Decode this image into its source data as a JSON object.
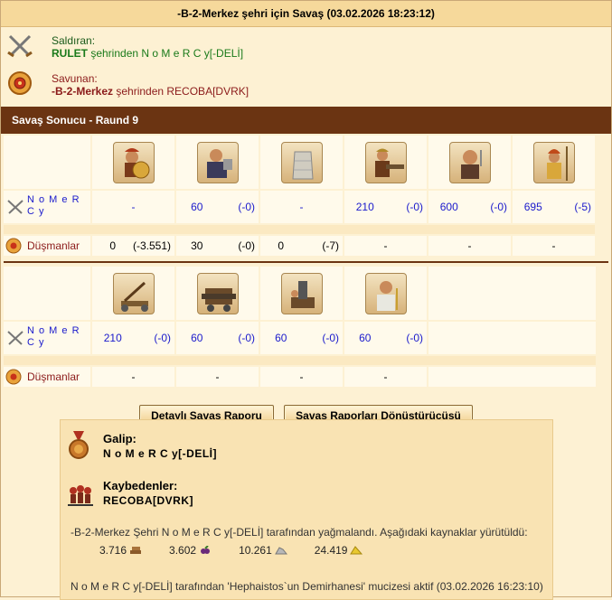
{
  "title": "-B-2-Merkez şehri için Savaş (03.02.2026 18:23:12)",
  "attacker": {
    "label": "Saldıran:",
    "city": "RULET",
    "text": " şehrinden N o M e R C y[-DELİ]",
    "icon": "crossed-swords-icon"
  },
  "defender": {
    "label": "Savunan:",
    "city": "-B-2-Merkez",
    "text": " şehrinden RECOBA[DVRK]",
    "icon": "shield-icon"
  },
  "result_bar": "Savaş Sonucu - Raund 9",
  "player_short": "N o M e R C y",
  "enemies_label": "Düşmanlar",
  "block1": {
    "units": [
      {
        "icon": "hoplite-icon"
      },
      {
        "icon": "steam-giant-icon"
      },
      {
        "icon": "wall-icon"
      },
      {
        "icon": "gunner-icon"
      },
      {
        "icon": "swordsman-icon"
      },
      {
        "icon": "spearman-icon"
      }
    ],
    "mine": [
      {
        "a": "-",
        "b": ""
      },
      {
        "a": "60",
        "b": "(-0)"
      },
      {
        "a": "-",
        "b": ""
      },
      {
        "a": "210",
        "b": "(-0)"
      },
      {
        "a": "600",
        "b": "(-0)"
      },
      {
        "a": "695",
        "b": "(-5)"
      }
    ],
    "enemy": [
      {
        "a": "0",
        "b": "(-3.551)"
      },
      {
        "a": "30",
        "b": "(-0)"
      },
      {
        "a": "0",
        "b": "(-7)"
      },
      {
        "a": "-",
        "b": ""
      },
      {
        "a": "-",
        "b": ""
      },
      {
        "a": "-",
        "b": ""
      }
    ]
  },
  "block2": {
    "units": [
      {
        "icon": "catapult-icon"
      },
      {
        "icon": "ram-icon"
      },
      {
        "icon": "mortar-icon"
      },
      {
        "icon": "doctor-icon"
      }
    ],
    "mine": [
      {
        "a": "210",
        "b": "(-0)"
      },
      {
        "a": "60",
        "b": "(-0)"
      },
      {
        "a": "60",
        "b": "(-0)"
      },
      {
        "a": "60",
        "b": "(-0)"
      }
    ],
    "enemy": [
      {
        "a": "-",
        "b": ""
      },
      {
        "a": "-",
        "b": ""
      },
      {
        "a": "-",
        "b": ""
      },
      {
        "a": "-",
        "b": ""
      }
    ]
  },
  "buttons": {
    "detailed": "Detaylı Savaş Raporu",
    "converter": "Savaş Raporları Dönüştürücüsü"
  },
  "outcome": {
    "winner_label": "Galip:",
    "winner": "N o M e R C y[-DELİ]",
    "loser_label": "Kaybedenler:",
    "loser": "RECOBA[DVRK]",
    "loot_text": "-B-2-Merkez Şehri N o M e R C y[-DELİ] tarafından yağmalandı. Aşağıdaki kaynaklar yürütüldü:",
    "loot": [
      {
        "amount": "3.716",
        "icon": "wood-icon"
      },
      {
        "amount": "3.602",
        "icon": "wine-icon"
      },
      {
        "amount": "10.261",
        "icon": "marble-icon"
      },
      {
        "amount": "24.419",
        "icon": "sulfur-icon"
      }
    ],
    "miracle": "N o M e R C y[-DELİ] tarafından 'Hephaistos`un Demirhanesi' mucizesi aktif (03.02.2026 16:23:10)"
  },
  "colors": {
    "bar": "#6b3412",
    "player": "#1a1acc",
    "enemy": "#8b1a1a",
    "attacker_city": "#1a7a1a"
  }
}
